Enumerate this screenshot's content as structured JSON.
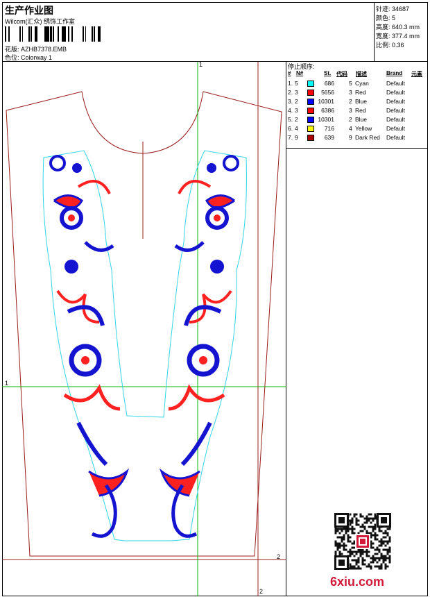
{
  "header": {
    "title": "生产作业图",
    "company": "Wilcom(汇众) 绣饰工作室",
    "design_label": "花版:",
    "design_value": "AZHB7378.EMB",
    "colorway_label": "色位:",
    "colorway_value": "Colorway 1"
  },
  "stats": {
    "stitches": "针迹: 34687",
    "colors": "颜色: 5",
    "height": "高度: 640.3 mm",
    "width": "宽度: 377.4 mm",
    "scale": "比例: 0.36"
  },
  "sequence": {
    "title": "停止顺序:",
    "headers": [
      "#",
      "N#",
      "St.",
      "代码",
      "描述",
      "Brand",
      "元素"
    ],
    "rows": [
      {
        "idx": "1.",
        "n": "5",
        "color": "#00ffff",
        "st": "686",
        "code": "5",
        "desc": "Cyan",
        "brand": "Default"
      },
      {
        "idx": "2.",
        "n": "3",
        "color": "#ff0000",
        "st": "5656",
        "code": "3",
        "desc": "Red",
        "brand": "Default"
      },
      {
        "idx": "3.",
        "n": "2",
        "color": "#0000ff",
        "st": "10301",
        "code": "2",
        "desc": "Blue",
        "brand": "Default"
      },
      {
        "idx": "4.",
        "n": "3",
        "color": "#ff0000",
        "st": "6386",
        "code": "3",
        "desc": "Red",
        "brand": "Default"
      },
      {
        "idx": "5.",
        "n": "2",
        "color": "#0000ff",
        "st": "10301",
        "code": "2",
        "desc": "Blue",
        "brand": "Default"
      },
      {
        "idx": "6.",
        "n": "4",
        "color": "#ffff00",
        "st": "716",
        "code": "4",
        "desc": "Yellow",
        "brand": "Default"
      },
      {
        "idx": "7.",
        "n": "9",
        "color": "#aa0000",
        "st": "639",
        "code": "9",
        "desc": "Dark Red",
        "brand": "Default"
      }
    ]
  },
  "axes": {
    "v1": "1",
    "h1": "1",
    "v2": "2",
    "h2": "2"
  },
  "watermark": "6xiu.com",
  "colors": {
    "outline": "#9b1c1c",
    "guide": "#00c000",
    "cyan": "#30d5e6",
    "red": "#ff2020",
    "blue": "#1414d0"
  }
}
